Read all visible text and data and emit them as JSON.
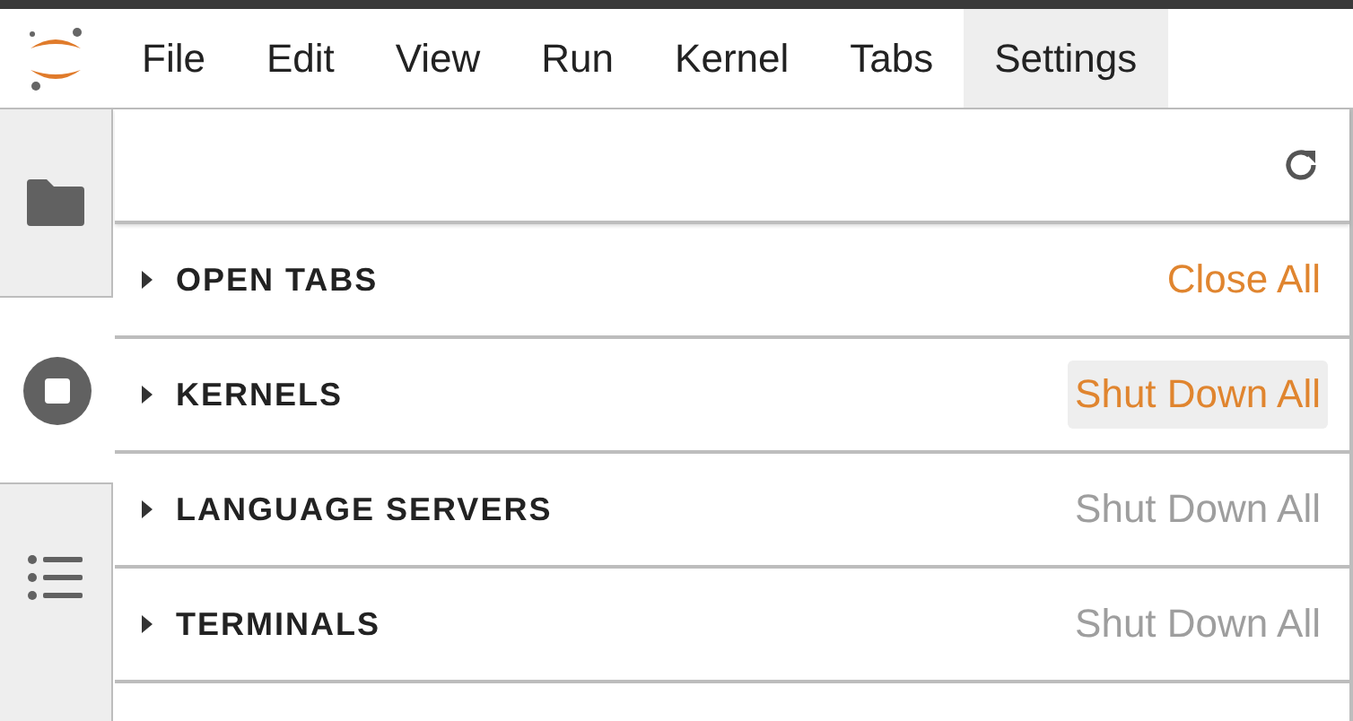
{
  "menu": [
    {
      "label": "File",
      "selected": false
    },
    {
      "label": "Edit",
      "selected": false
    },
    {
      "label": "View",
      "selected": false
    },
    {
      "label": "Run",
      "selected": false
    },
    {
      "label": "Kernel",
      "selected": false
    },
    {
      "label": "Tabs",
      "selected": false
    },
    {
      "label": "Settings",
      "selected": true
    }
  ],
  "sidebar": {
    "tabs": [
      {
        "kind": "folder",
        "selected": false
      },
      {
        "kind": "running",
        "selected": true
      },
      {
        "kind": "toc",
        "selected": false
      }
    ]
  },
  "sections": [
    {
      "title": "OPEN TABS",
      "expanded": false,
      "action": {
        "label": "Close All",
        "disabled": false,
        "highlighted": false
      }
    },
    {
      "title": "KERNELS",
      "expanded": false,
      "action": {
        "label": "Shut Down All",
        "disabled": false,
        "highlighted": true
      }
    },
    {
      "title": "LANGUAGE SERVERS",
      "expanded": false,
      "action": {
        "label": "Shut Down All",
        "disabled": true,
        "highlighted": false
      }
    },
    {
      "title": "TERMINALS",
      "expanded": false,
      "action": {
        "label": "Shut Down All",
        "disabled": true,
        "highlighted": false
      }
    }
  ]
}
